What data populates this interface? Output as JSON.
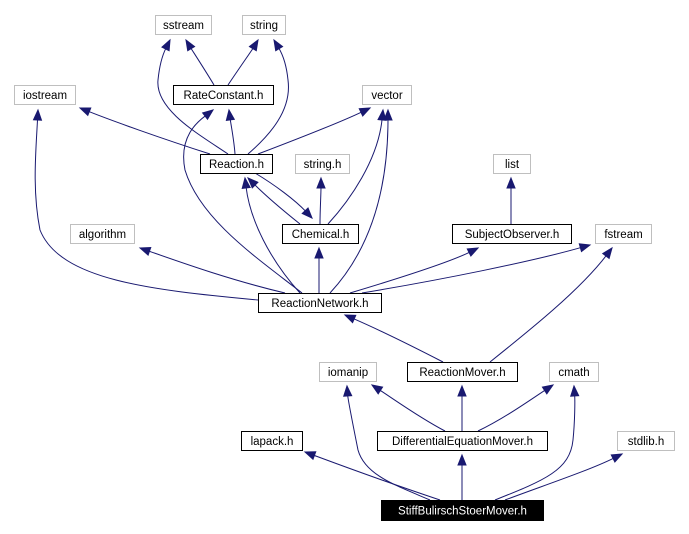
{
  "diagram": {
    "type": "include-dependency-graph",
    "colors": {
      "edge": "#191970",
      "documented_border": "#000000",
      "system_border": "#bfbfbf",
      "root_fill": "#000000",
      "root_text": "#ffffff"
    },
    "nodes": [
      {
        "id": "sstream",
        "label": "sstream",
        "kind": "system"
      },
      {
        "id": "string",
        "label": "string",
        "kind": "system"
      },
      {
        "id": "iostream",
        "label": "iostream",
        "kind": "system"
      },
      {
        "id": "RateConstant",
        "label": "RateConstant.h",
        "kind": "documented"
      },
      {
        "id": "vector",
        "label": "vector",
        "kind": "system"
      },
      {
        "id": "Reaction",
        "label": "Reaction.h",
        "kind": "documented"
      },
      {
        "id": "stringh",
        "label": "string.h",
        "kind": "system"
      },
      {
        "id": "list",
        "label": "list",
        "kind": "system"
      },
      {
        "id": "algorithm",
        "label": "algorithm",
        "kind": "system"
      },
      {
        "id": "Chemical",
        "label": "Chemical.h",
        "kind": "documented"
      },
      {
        "id": "SubjectObserver",
        "label": "SubjectObserver.h",
        "kind": "documented"
      },
      {
        "id": "fstream",
        "label": "fstream",
        "kind": "system"
      },
      {
        "id": "ReactionNetwork",
        "label": "ReactionNetwork.h",
        "kind": "documented"
      },
      {
        "id": "iomanip",
        "label": "iomanip",
        "kind": "system"
      },
      {
        "id": "ReactionMover",
        "label": "ReactionMover.h",
        "kind": "documented"
      },
      {
        "id": "cmath",
        "label": "cmath",
        "kind": "system"
      },
      {
        "id": "lapack",
        "label": "lapack.h",
        "kind": "documented"
      },
      {
        "id": "DiffEqMover",
        "label": "DifferentialEquationMover.h",
        "kind": "documented"
      },
      {
        "id": "stdlib",
        "label": "stdlib.h",
        "kind": "system"
      },
      {
        "id": "StiffBS",
        "label": "StiffBulirschStoerMover.h",
        "kind": "root"
      }
    ],
    "edges": [
      {
        "from": "RateConstant",
        "to": "sstream"
      },
      {
        "from": "RateConstant",
        "to": "string"
      },
      {
        "from": "Reaction",
        "to": "sstream"
      },
      {
        "from": "Reaction",
        "to": "string"
      },
      {
        "from": "Reaction",
        "to": "iostream"
      },
      {
        "from": "Reaction",
        "to": "RateConstant"
      },
      {
        "from": "Reaction",
        "to": "vector"
      },
      {
        "from": "Reaction",
        "to": "Chemical"
      },
      {
        "from": "Chemical",
        "to": "Reaction"
      },
      {
        "from": "Chemical",
        "to": "stringh"
      },
      {
        "from": "Chemical",
        "to": "vector"
      },
      {
        "from": "SubjectObserver",
        "to": "list"
      },
      {
        "from": "ReactionNetwork",
        "to": "iostream"
      },
      {
        "from": "ReactionNetwork",
        "to": "RateConstant"
      },
      {
        "from": "ReactionNetwork",
        "to": "vector"
      },
      {
        "from": "ReactionNetwork",
        "to": "Reaction"
      },
      {
        "from": "ReactionNetwork",
        "to": "algorithm"
      },
      {
        "from": "ReactionNetwork",
        "to": "Chemical"
      },
      {
        "from": "ReactionNetwork",
        "to": "SubjectObserver"
      },
      {
        "from": "ReactionNetwork",
        "to": "fstream"
      },
      {
        "from": "ReactionMover",
        "to": "ReactionNetwork"
      },
      {
        "from": "ReactionMover",
        "to": "fstream"
      },
      {
        "from": "DiffEqMover",
        "to": "iomanip"
      },
      {
        "from": "DiffEqMover",
        "to": "ReactionMover"
      },
      {
        "from": "DiffEqMover",
        "to": "cmath"
      },
      {
        "from": "StiffBS",
        "to": "lapack"
      },
      {
        "from": "StiffBS",
        "to": "iomanip"
      },
      {
        "from": "StiffBS",
        "to": "DiffEqMover"
      },
      {
        "from": "StiffBS",
        "to": "cmath"
      },
      {
        "from": "StiffBS",
        "to": "stdlib"
      }
    ]
  }
}
